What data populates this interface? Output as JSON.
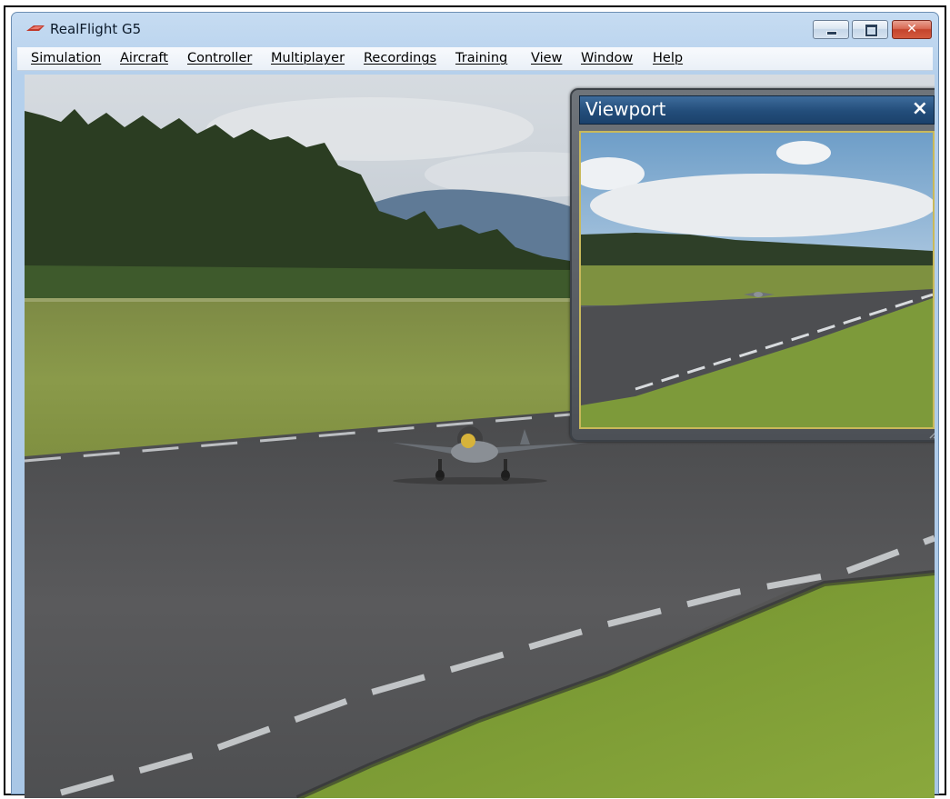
{
  "window": {
    "title": "RealFlight G5",
    "logo_icon": "realflight-logo-icon",
    "buttons": {
      "minimize_icon": "minimize-icon",
      "maximize_icon": "maximize-icon",
      "close_icon": "close-icon",
      "close_glyph": "✕"
    },
    "colors": {
      "title_bar": "#b5d0ec",
      "close_button": "#c4442c"
    }
  },
  "menubar": {
    "items": [
      "Simulation",
      "Aircraft",
      "Controller",
      "Multiplayer",
      "Recordings",
      "Training",
      "View",
      "Window",
      "Help"
    ]
  },
  "scene": {
    "description_icons": [
      "sky",
      "tree-line",
      "mountains",
      "grass-field",
      "runway",
      "aircraft-icon"
    ]
  },
  "viewport": {
    "title": "Viewport",
    "close_glyph": "×",
    "colors": {
      "header": "#234d7a",
      "screen_border": "#c9b95a"
    }
  }
}
